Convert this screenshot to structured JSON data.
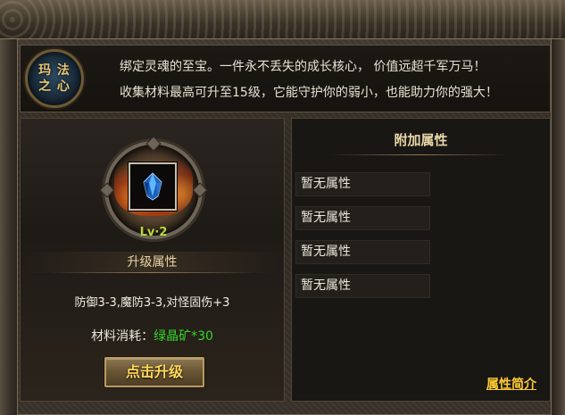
{
  "banner": {
    "emblem_text": "玛法之心",
    "emblem_line1": "玛 法",
    "emblem_line2": "之 心",
    "line1": "绑定灵魂的至宝。一件永不丢失的成长核心， 价值远超千军万马！",
    "line2": "收集材料最高可升至15级，它能守护你的弱小，也能助力你的强大！"
  },
  "item": {
    "icon": "blue-crystal-icon",
    "level": "Lv·2"
  },
  "upgrade_section": {
    "title": "升级属性",
    "stats": "防御3-3,魔防3-3,对怪固伤+3",
    "cost_label": "材料消耗：",
    "cost_value": "绿晶矿*30",
    "button_label": "点击升级"
  },
  "extra_attributes": {
    "title": "附加属性",
    "rows": [
      "暂无属性",
      "暂无属性",
      "暂无属性",
      "暂无属性"
    ],
    "link_label": "属性简介"
  },
  "colors": {
    "level": "#b9d83a",
    "cost_value": "#34d52a",
    "button_text": "#ffd85a",
    "link": "#ffcc33"
  }
}
